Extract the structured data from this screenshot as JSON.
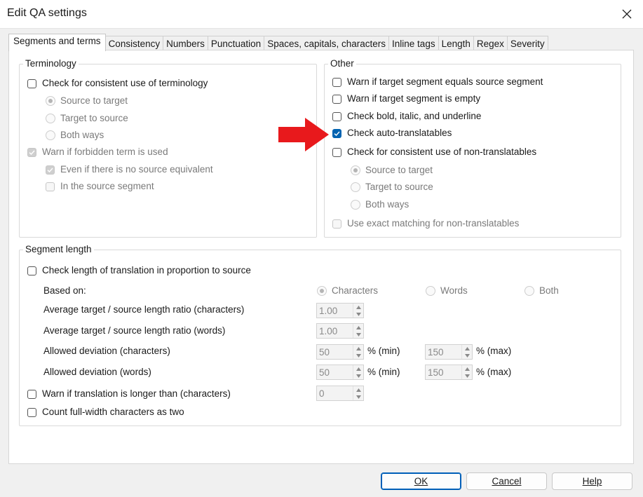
{
  "window": {
    "title": "Edit QA settings",
    "close_icon": "close-icon"
  },
  "tabs": [
    "Segments and terms",
    "Consistency",
    "Numbers",
    "Punctuation",
    "Spaces, capitals, characters",
    "Inline tags",
    "Length",
    "Regex",
    "Severity"
  ],
  "active_tab": "Segments and terms",
  "terminology": {
    "label": "Terminology",
    "check_consistent": "Check for consistent use of terminology",
    "radio_source_to_target": "Source to target",
    "radio_target_to_source": "Target to source",
    "radio_both_ways": "Both ways",
    "warn_forbidden": "Warn if forbidden term is used",
    "even_if_no_source": "Even if there is no source equivalent",
    "in_source_segment": "In the source segment"
  },
  "other": {
    "label": "Other",
    "warn_equals": "Warn if target segment equals source segment",
    "warn_empty": "Warn if target segment is empty",
    "check_bold": "Check bold, italic, and underline",
    "check_auto": "Check auto-translatables",
    "check_nontrans": "Check for consistent use of non-translatables",
    "radio_source_to_target": "Source to target",
    "radio_target_to_source": "Target to source",
    "radio_both_ways": "Both ways",
    "use_exact": "Use exact matching for non-translatables"
  },
  "segment_length": {
    "label": "Segment length",
    "check_length": "Check length of translation in proportion to source",
    "based_on": "Based on:",
    "opt_characters": "Characters",
    "opt_words": "Words",
    "opt_both": "Both",
    "avg_ratio_chars": "Average target / source length ratio (characters)",
    "avg_ratio_chars_value": "1.00",
    "avg_ratio_words": "Average target / source length ratio (words)",
    "avg_ratio_words_value": "1.00",
    "dev_chars": "Allowed deviation (characters)",
    "dev_chars_min": "50",
    "dev_chars_max": "150",
    "dev_words": "Allowed deviation (words)",
    "dev_words_min": "50",
    "dev_words_max": "150",
    "min_suffix": "% (min)",
    "max_suffix": "% (max)",
    "warn_longer": "Warn if translation is longer than (characters)",
    "warn_longer_value": "0",
    "count_fullwidth": "Count full-width characters as two"
  },
  "buttons": {
    "ok": "OK",
    "cancel": "Cancel",
    "help": "Help"
  },
  "colors": {
    "accent": "#0063b1",
    "arrow": "#e8191c",
    "panel": "#ffffff",
    "window_bg": "#f0f0f0"
  }
}
